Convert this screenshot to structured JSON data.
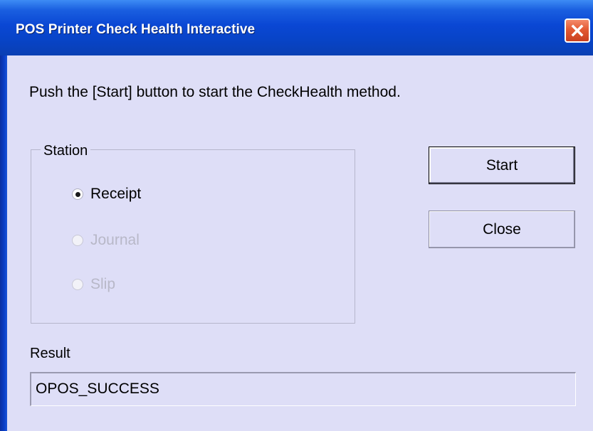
{
  "window": {
    "title": "POS Printer Check Health Interactive"
  },
  "dialog": {
    "instruction": "Push the [Start] button to start the CheckHealth method.",
    "station": {
      "label": "Station",
      "options": [
        {
          "label": "Receipt",
          "selected": true,
          "enabled": true
        },
        {
          "label": "Journal",
          "selected": false,
          "enabled": false
        },
        {
          "label": "Slip",
          "selected": false,
          "enabled": false
        }
      ]
    },
    "buttons": {
      "start": "Start",
      "close": "Close"
    },
    "result": {
      "label": "Result",
      "value": "OPOS_SUCCESS"
    }
  },
  "colors": {
    "titlebar": "#0a47d4",
    "client": "#dedef7",
    "close_button": "#e35a33"
  }
}
